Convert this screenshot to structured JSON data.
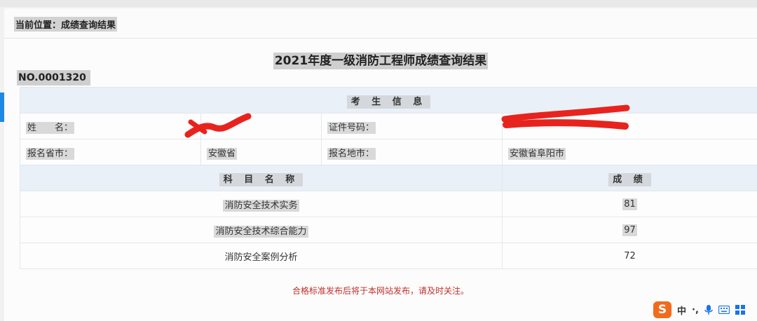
{
  "breadcrumb": "当前位置：成绩查询结果",
  "title": "2021年度一级消防工程师成绩查询结果",
  "serial": "NO.0001320",
  "candidate_section": "考 生 信 息",
  "fields": {
    "name_label": "姓　　名：",
    "name_value": "",
    "id_label": "证件号码：",
    "id_value": "",
    "province_label": "报名省市：",
    "province_value": "安徽省",
    "city_label": "报名地市：",
    "city_value": "安徽省阜阳市"
  },
  "scores_table": {
    "col_subject": "科 目 名 称",
    "col_score": "成 绩",
    "rows": [
      {
        "subject": "消防安全技术实务",
        "score": "81"
      },
      {
        "subject": "消防安全技术综合能力",
        "score": "97"
      },
      {
        "subject": "消防安全案例分析",
        "score": "72"
      }
    ]
  },
  "notice": "合格标准发布后将于本网站发布，请及时关注。",
  "ime": {
    "logo": "S",
    "lang": "中",
    "punct": "·,",
    "mic_icon": "mic-icon",
    "keyboard_icon": "keyboard-icon",
    "menu_icon": "grid-icon"
  },
  "colors": {
    "redaction": "#e8231e",
    "notice": "#c0302b",
    "header_bg": "#eaf0f7"
  }
}
